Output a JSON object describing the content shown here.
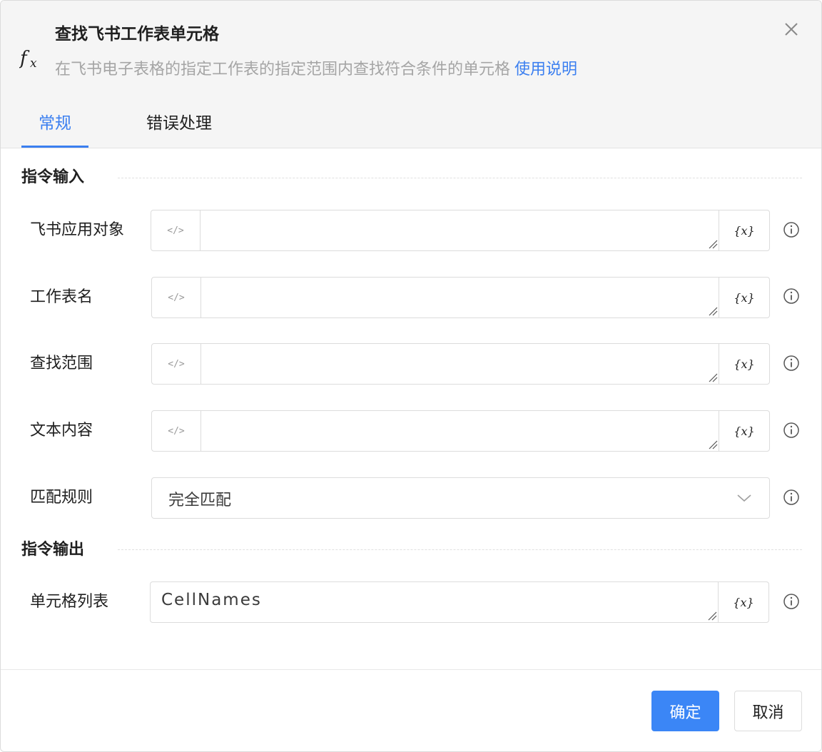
{
  "header": {
    "title": "查找飞书工作表单元格",
    "subtitle": "在飞书电子表格的指定工作表的指定范围内查找符合条件的单元格",
    "help_link": "使用说明",
    "fx_icon": "fx-icon",
    "close_icon": "close-icon"
  },
  "tabs": [
    {
      "label": "常规",
      "active": true
    },
    {
      "label": "错误处理",
      "active": false
    }
  ],
  "sections": {
    "input_title": "指令输入",
    "output_title": "指令输出"
  },
  "fields": {
    "feishu_app": {
      "label": "飞书应用对象",
      "value": ""
    },
    "sheet_name": {
      "label": "工作表名",
      "value": ""
    },
    "search_range": {
      "label": "查找范围",
      "value": ""
    },
    "text_content": {
      "label": "文本内容",
      "value": ""
    },
    "match_rule": {
      "label": "匹配规则",
      "value": "完全匹配"
    },
    "cell_list": {
      "label": "单元格列表",
      "value": "CellNames"
    }
  },
  "widgets": {
    "code_glyph": "</>",
    "var_glyph": "{x}"
  },
  "footer": {
    "ok_label": "确定",
    "cancel_label": "取消"
  },
  "colors": {
    "accent": "#3b7ff0",
    "primary_button": "#3b86f6"
  }
}
